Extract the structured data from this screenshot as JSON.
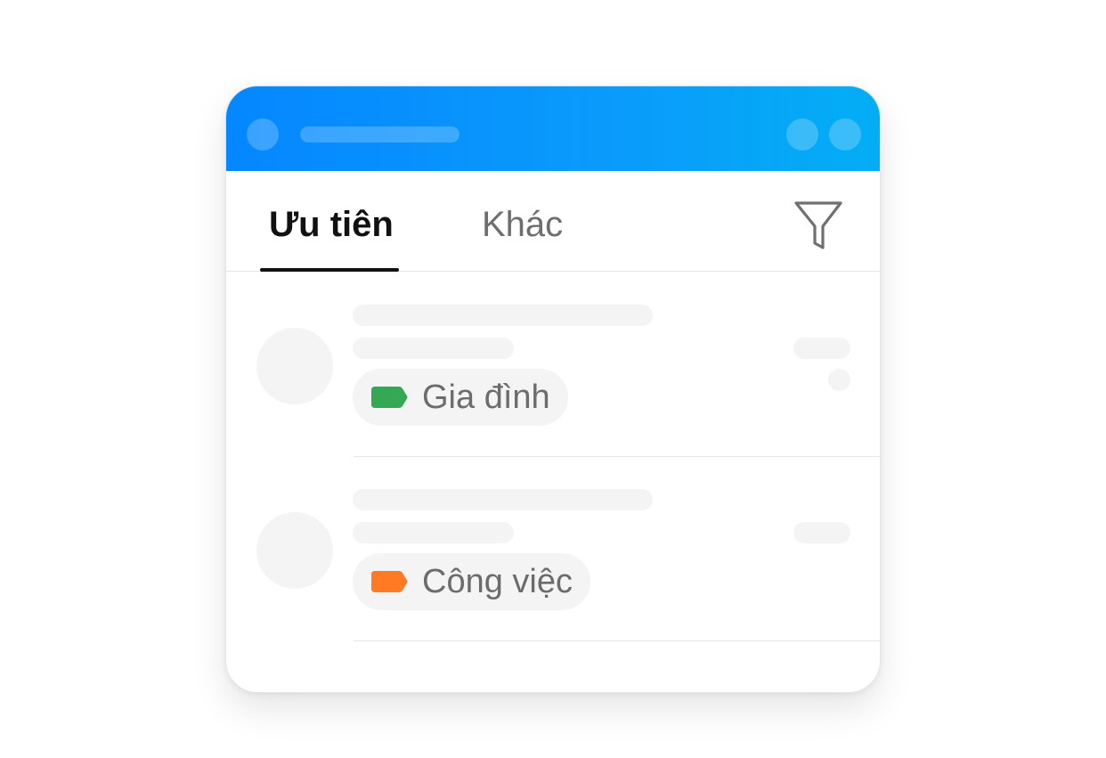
{
  "tabs": {
    "active_label": "Ưu tiên",
    "inactive_label": "Khác"
  },
  "filter": {
    "icon": "filter-icon"
  },
  "messages": [
    {
      "label": "Gia đình",
      "label_color": "#34a853",
      "icon": "label-tag-icon"
    },
    {
      "label": "Công việc",
      "label_color": "#ff7b23",
      "icon": "label-tag-icon"
    }
  ],
  "colors": {
    "titlebar_start": "#0587ff",
    "titlebar_end": "#03aef5",
    "skeleton": "#f4f4f4"
  }
}
